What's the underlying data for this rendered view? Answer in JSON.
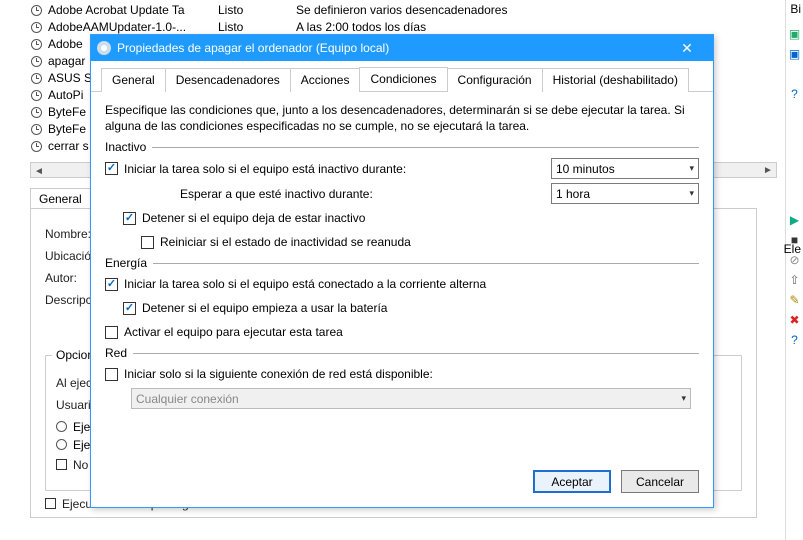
{
  "background": {
    "tasks": [
      {
        "name": "Adobe Acrobat Update Ta",
        "status": "Listo",
        "trigger": "Se definieron varios desencadenadores"
      },
      {
        "name": "AdobeAAMUpdater-1.0-...",
        "status": "Listo",
        "trigger": "A las 2:00 todos los días"
      },
      {
        "name": "Adobe",
        "status": "",
        "trigger": ""
      },
      {
        "name": "apagar",
        "status": "",
        "trigger": ""
      },
      {
        "name": "ASUS S",
        "status": "",
        "trigger": ""
      },
      {
        "name": "AutoPi",
        "status": "",
        "trigger": ""
      },
      {
        "name": "ByteFe",
        "status": "",
        "trigger": ""
      },
      {
        "name": "ByteFe",
        "status": "",
        "trigger": ""
      },
      {
        "name": "cerrar s",
        "status": "",
        "trigger": ""
      }
    ],
    "tabs": {
      "general": "General"
    },
    "labels": {
      "nombre": "Nombre:",
      "ubicacion": "Ubicació",
      "autor": "Autor:",
      "descripcion": "Descripc"
    },
    "security_group": "Opcion",
    "lines": {
      "l1": "Al ejecu",
      "l2": "Usuario",
      "r1": "Ejec",
      "r2": "Ejec",
      "ck1": "No almacenar la contraseña. La tarea solo tendrá acceso a los recursos locales",
      "ck2": "Ejecutar con los privilegios más elevados"
    }
  },
  "sidebar": {
    "ele": "Ele",
    "bi": "Bi",
    "play": "▶",
    "stop": "■",
    "dis": "⊘",
    "exp": "⇧",
    "q": "?",
    "x": "✖",
    "refresh": "↻"
  },
  "dialog": {
    "title": "Propiedades de apagar el ordenador (Equipo local)",
    "tabs": {
      "general": "General",
      "triggers": "Desencadenadores",
      "actions": "Acciones",
      "conditions": "Condiciones",
      "config": "Configuración",
      "history": "Historial (deshabilitado)"
    },
    "intro": "Especifique las condiciones que, junto a los desencadenadores, determinarán si se debe ejecutar la tarea. Si alguna de las condiciones especificadas no se cumple, no se ejecutará la tarea.",
    "sections": {
      "idle": "Inactivo",
      "power": "Energía",
      "network": "Red"
    },
    "fields": {
      "start_if_idle": "Iniciar la tarea solo si el equipo está inactivo durante:",
      "idle_duration": "10 minutos",
      "wait_idle_label": "Esperar a que esté inactivo durante:",
      "wait_idle_value": "1 hora",
      "stop_if_not_idle": "Detener si el equipo deja de estar inactivo",
      "restart_if_idle": "Reiniciar si el estado de inactividad se reanuda",
      "start_on_ac": "Iniciar la tarea solo si el equipo está conectado a la corriente alterna",
      "stop_on_battery": "Detener si el equipo empieza a usar la batería",
      "wake_to_run": "Activar el equipo para ejecutar esta tarea",
      "start_if_net": "Iniciar solo si la siguiente conexión de red está disponible:",
      "net_option": "Cualquier conexión"
    },
    "buttons": {
      "ok": "Aceptar",
      "cancel": "Cancelar"
    }
  }
}
